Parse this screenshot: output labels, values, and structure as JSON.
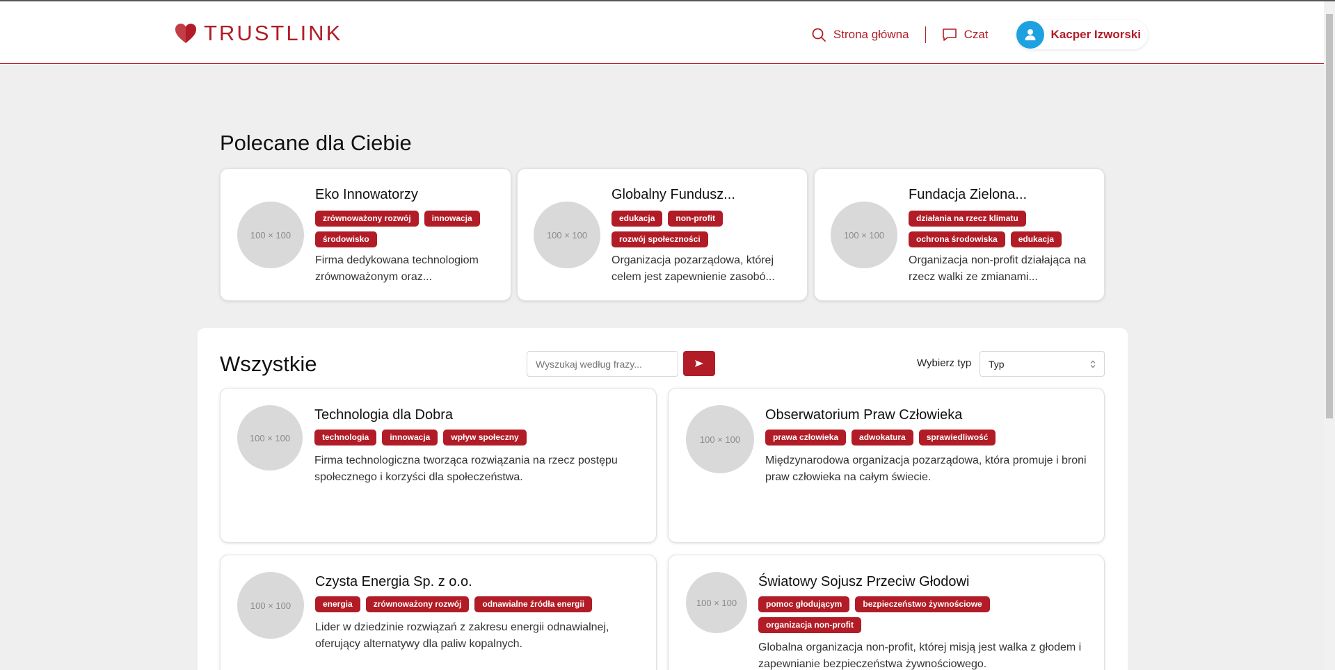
{
  "header": {
    "brand": "TRUSTLINK",
    "nav": {
      "home": "Strona główna",
      "chat": "Czat",
      "user": "Kacper Izworski"
    }
  },
  "recommended": {
    "title": "Polecane dla Ciebie",
    "cards": [
      {
        "placeholder": "100 × 100",
        "title": "Eko Innowatorzy",
        "tags": [
          "zrównoważony rozwój",
          "innowacja",
          "środowisko"
        ],
        "desc": "Firma dedykowana technologiom zrównoważonym oraz..."
      },
      {
        "placeholder": "100 × 100",
        "title": "Globalny Fundusz...",
        "tags": [
          "edukacja",
          "non-profit",
          "rozwój społeczności"
        ],
        "desc": "Organizacja pozarządowa, której celem jest zapewnienie zasobó..."
      },
      {
        "placeholder": "100 × 100",
        "title": "Fundacja Zielona...",
        "tags": [
          "działania na rzecz klimatu",
          "ochrona środowiska",
          "edukacja"
        ],
        "desc": "Organizacja non-profit działająca na rzecz walki ze zmianami..."
      }
    ]
  },
  "all": {
    "title": "Wszystkie",
    "search_placeholder": "Wyszukaj według frazy...",
    "type_label": "Wybierz typ",
    "type_value": "Typ",
    "cards": [
      {
        "placeholder": "100 × 100",
        "title": "Technologia dla Dobra",
        "tags": [
          "technologia",
          "innowacja",
          "wpływ społeczny"
        ],
        "desc": "Firma technologiczna tworząca rozwiązania na rzecz postępu społecznego i korzyści dla społeczeństwa."
      },
      {
        "placeholder": "100 × 100",
        "title": "Obserwatorium Praw Człowieka",
        "tags": [
          "prawa człowieka",
          "adwokatura",
          "sprawiedliwość"
        ],
        "desc": "Międzynarodowa organizacja pozarządowa, która promuje i broni praw człowieka na całym świecie."
      },
      {
        "placeholder": "100 × 100",
        "title": "Czysta Energia Sp. z o.o.",
        "tags": [
          "energia",
          "zrównoważony rozwój",
          "odnawialne źródła energii"
        ],
        "desc": "Lider w dziedzinie rozwiązań z zakresu energii odnawialnej, oferujący alternatywy dla paliw kopalnych."
      },
      {
        "placeholder": "100 × 100",
        "title": "Światowy Sojusz Przeciw Głodowi",
        "tags": [
          "pomoc głodującym",
          "bezpieczeństwo żywnościowe",
          "organizacja non-profit"
        ],
        "desc": "Globalna organizacja non-profit, której misją jest walka z głodem i zapewnianie bezpieczeństwa żywnościowego."
      }
    ]
  },
  "colors": {
    "accent": "#b11c26",
    "avatar": "#1da1e0",
    "background": "#efefef"
  }
}
